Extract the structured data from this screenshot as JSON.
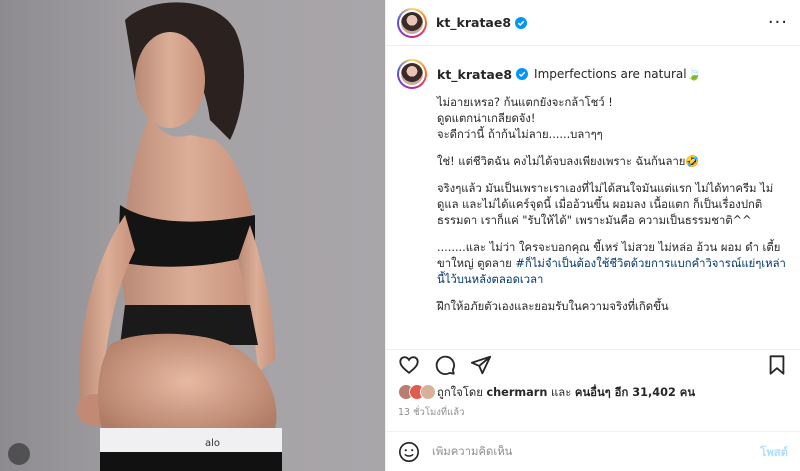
{
  "post": {
    "username": "kt_kratae8",
    "caption": {
      "title": "Imperfections are natural🍃",
      "paragraphs": [
        "ไม่อายเหรอ? ก้นแตกยังจะกล้าโชว์ !\nดูดแตกน่าเกลียดจัง!\nจะดีกว่านี้ ถ้าก้นไม่ลาย......บลาๆๆ",
        "ใช่! แต่ชีวิตฉัน คงไม่ได้จบลงเพียงเพราะ ฉันก้นลาย🤣",
        "จริงๆแล้ว มันเป็นเพราะเราเองที่ไม่ได้สนใจมันแต่แรก ไม่ได้ทาครีม ไม่ดูแล และไม่ได้แคร์จุดนี้ เมื่ออ้วนขึ้น ผอมลง เนื้อแตก ก็เป็นเรื่องปกติธรรมดา เราก็แค่ \"รับให้ได้\" เพราะมันคือ ความเป็นธรรมชาติ^^",
        "........และ ไม่ว่า ใครจะบอกคุณ ขี้เหร่ ไม่สวย ไม่หล่อ อ้วน ผอม ดำ เตี้ย ขาใหญ่ ตูดลาย"
      ],
      "hashtag": "#ก็ไม่จำเป็นต้องใช้ชีวิตด้วยการแบกคำวิจารณ์แย่ๆเหล่านี้ไว้บนหลังตลอดเวลา",
      "last_paragraph": "ฝึกให้อภัยตัวเองและยอมรับในความจริงที่เกิดขึ้น"
    },
    "likes": {
      "prefix": "ถูกใจโดย",
      "user": "chermarn",
      "middle": "และ",
      "others": "คนอื่นๆ อีก 31,402 คน"
    },
    "timestamp": "13 ชั่วโมงที่แล้ว",
    "comment_input": {
      "placeholder": "เพิ่มความคิดเห็น",
      "post_label": "โพสต์"
    }
  },
  "icons": {
    "more": "more-options-icon",
    "like": "heart-icon",
    "comment": "comment-icon",
    "share": "share-icon",
    "save": "bookmark-icon",
    "emoji": "emoji-icon",
    "verified": "verified-badge-icon"
  },
  "colors": {
    "verified": "#0095f6",
    "hashtag": "#00376b",
    "muted": "#8e8e8e",
    "post_button": "#b2dffc"
  }
}
